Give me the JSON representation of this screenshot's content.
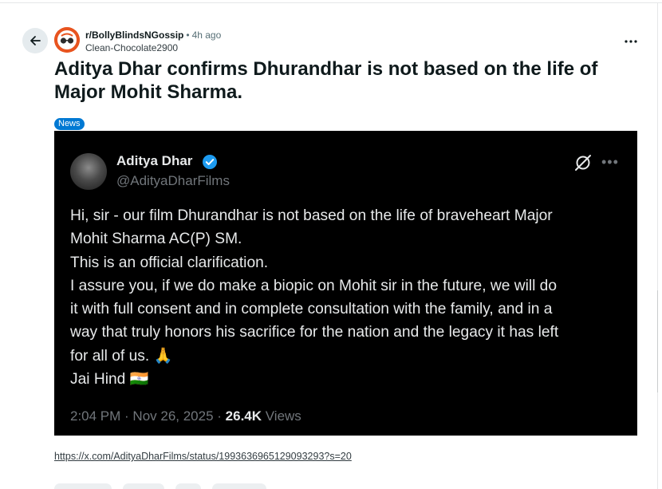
{
  "post": {
    "subreddit": "r/BollyBlindsNGossip",
    "separator": "•",
    "time_ago": "4h ago",
    "author": "Clean-Chocolate2900",
    "title": "Aditya Dhar confirms Dhurandhar is not based on the life of Major Mohit Sharma.",
    "flair": "News",
    "link": "https://x.com/AdityaDharFilms/status/1993636965129093293?s=20"
  },
  "tweet": {
    "name": "Aditya Dhar",
    "handle": "@AdityaDharFilms",
    "lines": [
      "Hi, sir - our film Dhurandhar is not based on the life of braveheart Major",
      "Mohit Sharma AC(P) SM.",
      "This is an official clarification.",
      "I assure you, if we do make a biopic on Mohit sir in the future, we will do",
      "it with full consent and in complete consultation with the family, and in a",
      "way that truly honors his sacrifice for the nation and the legacy it has left",
      "for all of us. 🙏",
      "Jai Hind 🇮🇳"
    ],
    "timestamp": "2:04 PM · Nov 26, 2025 · ",
    "views_count": "26.4K",
    "views_label": " Views"
  },
  "icons": {
    "back": "arrow-left-icon",
    "more": "three-dots-icon",
    "verified": "verified-badge-icon",
    "grok": "grok-icon"
  },
  "colors": {
    "flair_bg": "#0079d3",
    "tweet_bg": "#000000",
    "verified": "#1d9bf0",
    "subreddit_avatar": "#e8541f"
  }
}
